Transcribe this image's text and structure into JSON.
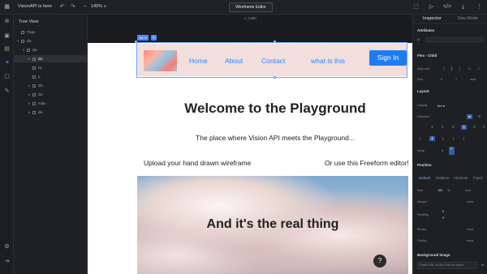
{
  "app": {
    "title": "VisionAPI is here",
    "zoom": "145%",
    "editor_label": "Wireframe Editor",
    "canvas_width": "1280"
  },
  "toolbar": {
    "undo": "↶",
    "redo": "↷",
    "zoom_minus": "−",
    "zoom_plus": "+"
  },
  "tree": {
    "title": "Tree View",
    "nodes": [
      {
        "label": "Page",
        "depth": 0,
        "arrow": ""
      },
      {
        "label": "div",
        "depth": 0,
        "arrow": "▾"
      },
      {
        "label": "div",
        "depth": 1,
        "arrow": "▾"
      },
      {
        "label": "div",
        "depth": 2,
        "arrow": "▸",
        "selected": true
      },
      {
        "label": "h1",
        "depth": 2,
        "arrow": "",
        "icon": "H"
      },
      {
        "label": "p",
        "depth": 2,
        "arrow": "",
        "icon": "T"
      },
      {
        "label": "div",
        "depth": 2,
        "arrow": "▸"
      },
      {
        "label": "div",
        "depth": 2,
        "arrow": "▸"
      },
      {
        "label": "main",
        "depth": 2,
        "arrow": "▸"
      },
      {
        "label": "div",
        "depth": 2,
        "arrow": "▸"
      }
    ]
  },
  "selection": {
    "tag": "div ▾"
  },
  "site": {
    "nav": [
      "Home",
      "About",
      "Contact",
      "what is this"
    ],
    "signin": "Sign In",
    "heading": "Welcome to the Playground",
    "tagline": "The place where Vision API meets the Playground...",
    "left_text": "Upload your hand drawn wireframe",
    "right_text": "Or use this Freeform editor!",
    "hero_text": "And it's the real thing",
    "help": "?"
  },
  "inspector": {
    "tabs": [
      "Inspector",
      "Dev Mode"
    ],
    "attributes": "Attributes",
    "attr_id": "id",
    "flex_child": "Flex - Child",
    "align_self": "Align self",
    "flex": "Flex",
    "flex_vals": [
      "0",
      "1",
      "auto"
    ],
    "layout": "Layout",
    "display": "Display",
    "display_val": "flex ▾",
    "direction": "Direction",
    "wrap": "Wrap",
    "position": "Position",
    "pos_tabs": [
      "Default",
      "Relative",
      "Absolute",
      "Fixed"
    ],
    "size": "Size",
    "size_val": "100",
    "size_unit": "%",
    "size_auto": "auto",
    "margin": "Margin",
    "margin_val": "none",
    "padding": "Padding",
    "padding_vals": [
      "5",
      "5"
    ],
    "border": "Border",
    "border_val": "none",
    "radius": "Radius",
    "radius_val": "none",
    "bg_image": "Background Image",
    "bg_placeholder": "Paste URL or Alt+Click an asset"
  }
}
